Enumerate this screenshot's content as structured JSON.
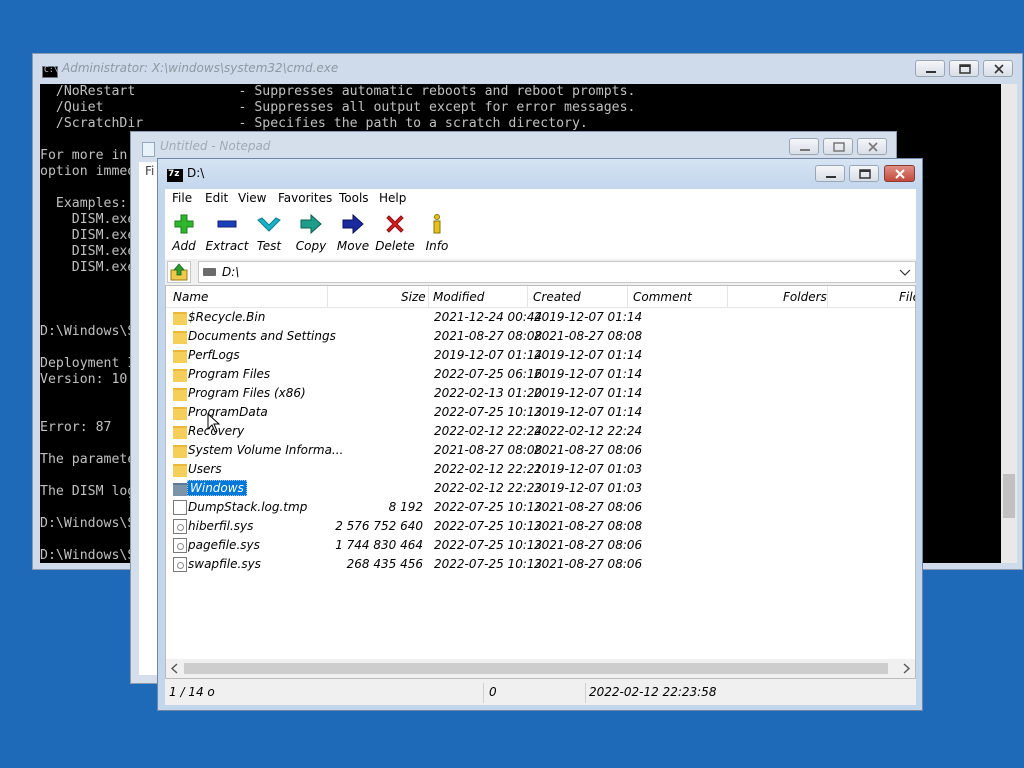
{
  "cmd": {
    "title": "Administrator: X:\\windows\\system32\\cmd.exe",
    "lines": [
      "  /NoRestart             - Suppresses automatic reboots and reboot prompts.",
      "  /Quiet                 - Suppresses all output except for error messages.",
      "  /ScratchDir            - Specifies the path to a scratch directory.",
      "",
      "For more in",
      "option immed",
      "",
      "  Examples:",
      "    DISM.exe",
      "    DISM.exe",
      "    DISM.exe",
      "    DISM.exe",
      "",
      "",
      "",
      "D:\\Windows\\S",
      "",
      "Deployment I",
      "Version: 10",
      "",
      "",
      "Error: 87",
      "",
      "The paramete",
      "",
      "The DISM log",
      "",
      "D:\\Windows\\S",
      "",
      "D:\\Windows\\S"
    ]
  },
  "notepad": {
    "title": "Untitled - Notepad",
    "menu_first": "Fi"
  },
  "zip": {
    "title": "D:\\",
    "menu": [
      "File",
      "Edit",
      "View",
      "Favorites",
      "Tools",
      "Help"
    ],
    "toolbar": [
      {
        "label": "Add",
        "icon": "plus-icon",
        "color": "#2fb52f"
      },
      {
        "label": "Extract",
        "icon": "minus-icon",
        "color": "#1a3fb8"
      },
      {
        "label": "Test",
        "icon": "check-icon",
        "color": "#19b3c7"
      },
      {
        "label": "Copy",
        "icon": "copy-arrow-icon",
        "color": "#1e9e8a"
      },
      {
        "label": "Move",
        "icon": "move-arrow-icon",
        "color": "#1b2a9e"
      },
      {
        "label": "Delete",
        "icon": "delete-x-icon",
        "color": "#d81e1e"
      },
      {
        "label": "Info",
        "icon": "info-icon",
        "color": "#e5c21b"
      }
    ],
    "address": "D:\\",
    "columns": [
      "Name",
      "Size",
      "Modified",
      "Created",
      "Comment",
      "Folders",
      "File"
    ],
    "rows": [
      {
        "name": "$Recycle.Bin",
        "size": "",
        "modified": "2021-12-24 00:44",
        "created": "2019-12-07 01:14",
        "type": "folder"
      },
      {
        "name": "Documents and Settings",
        "size": "",
        "modified": "2021-08-27 08:08",
        "created": "2021-08-27 08:08",
        "type": "folder"
      },
      {
        "name": "PerfLogs",
        "size": "",
        "modified": "2019-12-07 01:14",
        "created": "2019-12-07 01:14",
        "type": "folder"
      },
      {
        "name": "Program Files",
        "size": "",
        "modified": "2022-07-25 06:16",
        "created": "2019-12-07 01:14",
        "type": "folder"
      },
      {
        "name": "Program Files (x86)",
        "size": "",
        "modified": "2022-02-13 01:20",
        "created": "2019-12-07 01:14",
        "type": "folder"
      },
      {
        "name": "ProgramData",
        "size": "",
        "modified": "2022-07-25 10:13",
        "created": "2019-12-07 01:14",
        "type": "folder"
      },
      {
        "name": "Recovery",
        "size": "",
        "modified": "2022-02-12 22:24",
        "created": "2022-02-12 22:24",
        "type": "folder"
      },
      {
        "name": "System Volume Informa...",
        "size": "",
        "modified": "2021-08-27 08:08",
        "created": "2021-08-27 08:06",
        "type": "folder"
      },
      {
        "name": "Users",
        "size": "",
        "modified": "2022-02-12 22:21",
        "created": "2019-12-07 01:03",
        "type": "folder"
      },
      {
        "name": "Windows",
        "size": "",
        "modified": "2022-02-12 22:23",
        "created": "2019-12-07 01:03",
        "type": "folder",
        "selected": true
      },
      {
        "name": "DumpStack.log.tmp",
        "size": "8 192",
        "modified": "2022-07-25 10:13",
        "created": "2021-08-27 08:06",
        "type": "file"
      },
      {
        "name": "hiberfil.sys",
        "size": "2 576 752 640",
        "modified": "2022-07-25 10:13",
        "created": "2021-08-27 08:08",
        "type": "sys"
      },
      {
        "name": "pagefile.sys",
        "size": "1 744 830 464",
        "modified": "2022-07-25 10:13",
        "created": "2021-08-27 08:06",
        "type": "sys"
      },
      {
        "name": "swapfile.sys",
        "size": "268 435 456",
        "modified": "2022-07-25 10:13",
        "created": "2021-08-27 08:06",
        "type": "sys"
      }
    ],
    "status": {
      "selection": "1 / 14 o",
      "size": "0",
      "date": "2022-02-12 22:23:58"
    }
  }
}
